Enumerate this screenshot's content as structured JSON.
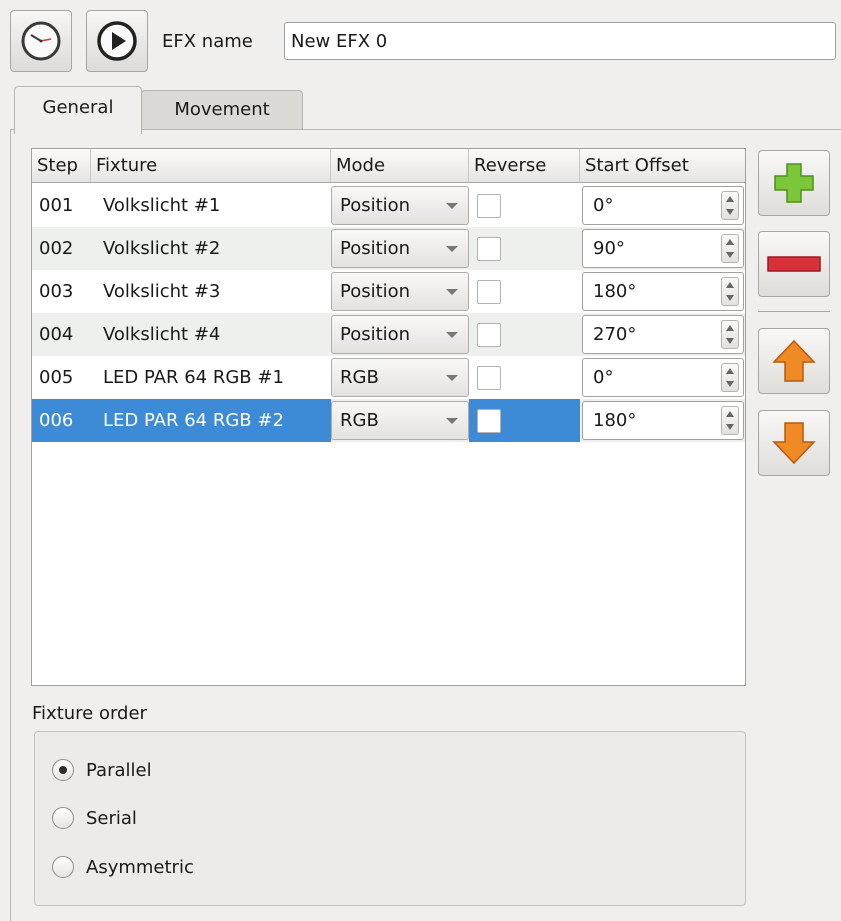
{
  "toolbar": {
    "efx_name_label": "EFX name",
    "efx_name_value": "New EFX 0"
  },
  "tabs": [
    {
      "label": "General",
      "active": true
    },
    {
      "label": "Movement",
      "active": false
    }
  ],
  "table": {
    "headers": [
      "Step",
      "Fixture",
      "Mode",
      "Reverse",
      "Start Offset"
    ],
    "rows": [
      {
        "step": "001",
        "fixture": "Volkslicht #1",
        "mode": "Position",
        "reverse": false,
        "offset": "0°",
        "selected": false
      },
      {
        "step": "002",
        "fixture": "Volkslicht #2",
        "mode": "Position",
        "reverse": false,
        "offset": "90°",
        "selected": false
      },
      {
        "step": "003",
        "fixture": "Volkslicht #3",
        "mode": "Position",
        "reverse": false,
        "offset": "180°",
        "selected": false
      },
      {
        "step": "004",
        "fixture": "Volkslicht #4",
        "mode": "Position",
        "reverse": false,
        "offset": "270°",
        "selected": false
      },
      {
        "step": "005",
        "fixture": "LED PAR 64 RGB #1",
        "mode": "RGB",
        "reverse": false,
        "offset": "0°",
        "selected": false
      },
      {
        "step": "006",
        "fixture": "LED PAR 64 RGB #2",
        "mode": "RGB",
        "reverse": false,
        "offset": "180°",
        "selected": true
      }
    ]
  },
  "side_buttons": {
    "icons": [
      "add-icon",
      "remove-icon",
      "raise-icon",
      "lower-icon"
    ]
  },
  "fixture_order": {
    "label": "Fixture order",
    "options": [
      {
        "label": "Parallel",
        "checked": true
      },
      {
        "label": "Serial",
        "checked": false
      },
      {
        "label": "Asymmetric",
        "checked": false
      }
    ]
  },
  "colors": {
    "selection": "#3d8bd6",
    "add_green": "#7cc63a",
    "remove_red": "#d9313a",
    "arrow_orange": "#f08a24"
  }
}
